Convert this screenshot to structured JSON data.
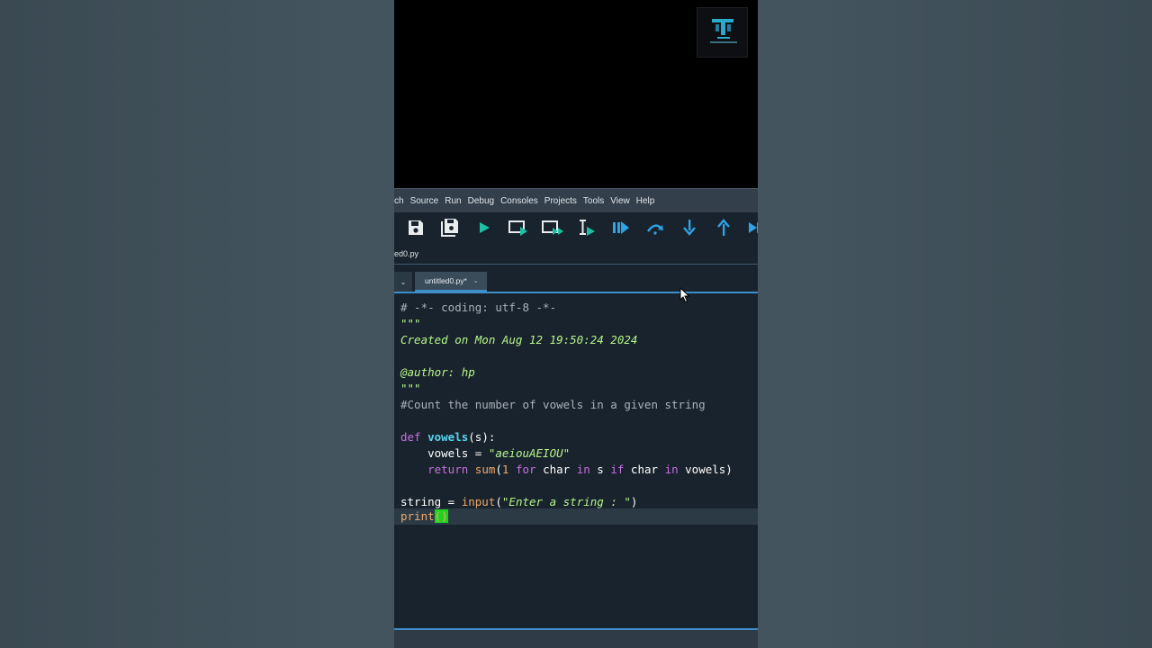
{
  "menu": {
    "items": [
      "ch",
      "Source",
      "Run",
      "Debug",
      "Consoles",
      "Projects",
      "Tools",
      "View",
      "Help"
    ]
  },
  "toolbar": {
    "icons": [
      "save-icon",
      "save-all-icon",
      "run-icon",
      "run-cell-icon",
      "run-cell-advance-icon",
      "run-selection-icon",
      "debug-icon",
      "step-over-icon",
      "step-into-icon",
      "step-return-icon",
      "continue-icon"
    ],
    "accent_color": "#1fbfa3",
    "blue_color": "#2fa3e6"
  },
  "file": {
    "path": "ed0.py"
  },
  "tabs": {
    "left_close": "⌄",
    "active_label": "untitled0.py*",
    "active_close": "⌄"
  },
  "code": {
    "l1": "# -*- coding: utf-8 -*-",
    "l2": "\"\"\"",
    "l3": "Created on Mon Aug 12 19:50:24 2024",
    "l5": "@author: hp",
    "l6": "\"\"\"",
    "l7": "#Count the number of vowels in a given string",
    "l9_kw": "def",
    "l9_fn": "vowels",
    "l9_rest": "(s):",
    "l10_a": "    vowels = ",
    "l10_str": "\"aeiouAEIOU\"",
    "l11_kw1": "return",
    "l11_fn": "sum",
    "l11_p1": "(",
    "l11_num": "1",
    "l11_kw2": "for",
    "l11_c1": " char ",
    "l11_kw3": "in",
    "l11_c2": " s ",
    "l11_kw4": "if",
    "l11_c3": " char ",
    "l11_kw5": "in",
    "l11_c4": " vowels)",
    "l13_a": "string = ",
    "l13_fn": "input",
    "l13_p": "(",
    "l13_str": "\"Enter a string : \"",
    "l13_close": ")",
    "l14_fn": "print",
    "l14_parens": "()"
  }
}
